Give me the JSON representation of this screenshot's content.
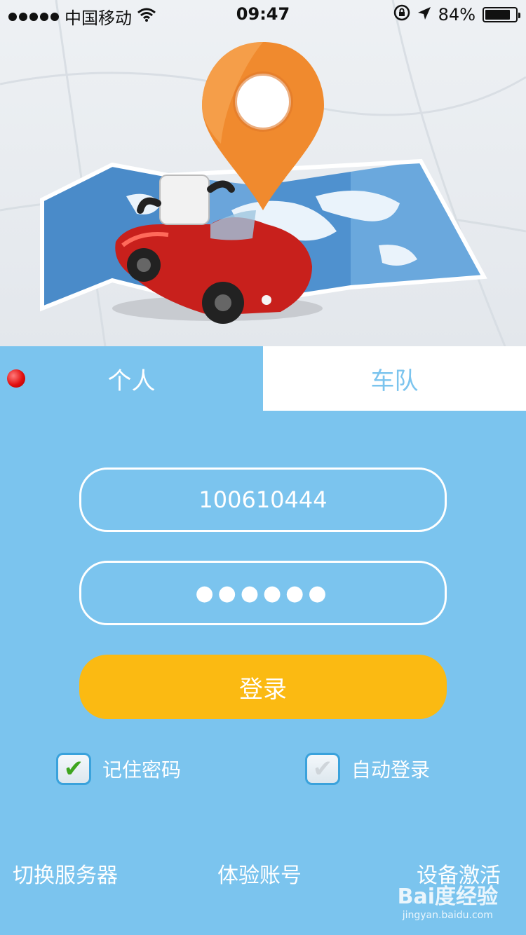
{
  "status_bar": {
    "carrier": "中国移动",
    "time": "09:47",
    "battery_percent": "84%",
    "battery_level": 0.84
  },
  "tabs": {
    "personal_label": "个人",
    "fleet_label": "车队",
    "active": "personal"
  },
  "form": {
    "username_value": "100610444",
    "password_masked": "●●●●●●",
    "login_label": "登录"
  },
  "options": {
    "remember_label": "记住密码",
    "remember_checked": true,
    "auto_login_label": "自动登录",
    "auto_login_checked": false
  },
  "bottom_links": {
    "switch_server": "切换服务器",
    "trial_account": "体验账号",
    "activate_device": "设备激活"
  },
  "watermark": {
    "logo": "Bai度经验",
    "url": "jingyan.baidu.com"
  },
  "colors": {
    "background": "#7bc4ee",
    "login_button": "#fbba12",
    "tab_inactive_bg": "#ffffff",
    "pin": "#f08a2e",
    "car": "#c8201c"
  }
}
